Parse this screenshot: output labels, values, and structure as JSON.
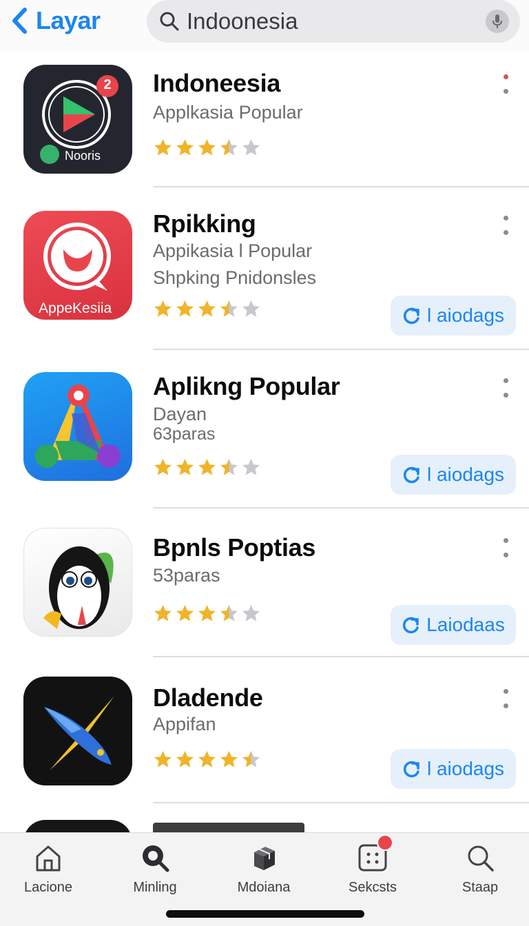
{
  "header": {
    "back_label": "Layar",
    "search_value": "Indoonesia"
  },
  "apps": [
    {
      "title": "Indoneesia",
      "subtitle": "Applkasia Popular",
      "subtitle2": "",
      "icon_text": "Nooris",
      "badge_text": "2",
      "rating": 3.5,
      "download_label": ""
    },
    {
      "title": "Rpikking",
      "subtitle": "Appikasia l Popular",
      "subtitle2": "Shpking Pnidonsles",
      "icon_text": "AppeKesiia",
      "rating": 3.5,
      "download_label": "l aiodags"
    },
    {
      "title": "Aplikng Popular",
      "subtitle": "Dayan",
      "subtitle2": "63paras",
      "icon_text": "",
      "rating": 3.5,
      "download_label": "l aiodags"
    },
    {
      "title": "Bpnls Poptias",
      "subtitle": "53paras",
      "subtitle2": "",
      "icon_text": "",
      "rating": 3.5,
      "download_label": "Laiodaas"
    },
    {
      "title": "Dladende",
      "subtitle": "Appifan",
      "subtitle2": "",
      "icon_text": "",
      "rating": 4.5,
      "download_label": "l aiodags"
    }
  ],
  "tabs": [
    {
      "label": "Lacione",
      "icon": "home-icon"
    },
    {
      "label": "Minling",
      "icon": "search-magnifier-icon"
    },
    {
      "label": "Mdoiana",
      "icon": "box-icon"
    },
    {
      "label": "Sekcsts",
      "icon": "apps-grid-icon"
    },
    {
      "label": "Staap",
      "icon": "search-icon"
    }
  ],
  "colors": {
    "accent": "#1a86f2",
    "star": "#f0b429",
    "star_empty": "#c7c7cc",
    "badge": "#e8454b"
  }
}
